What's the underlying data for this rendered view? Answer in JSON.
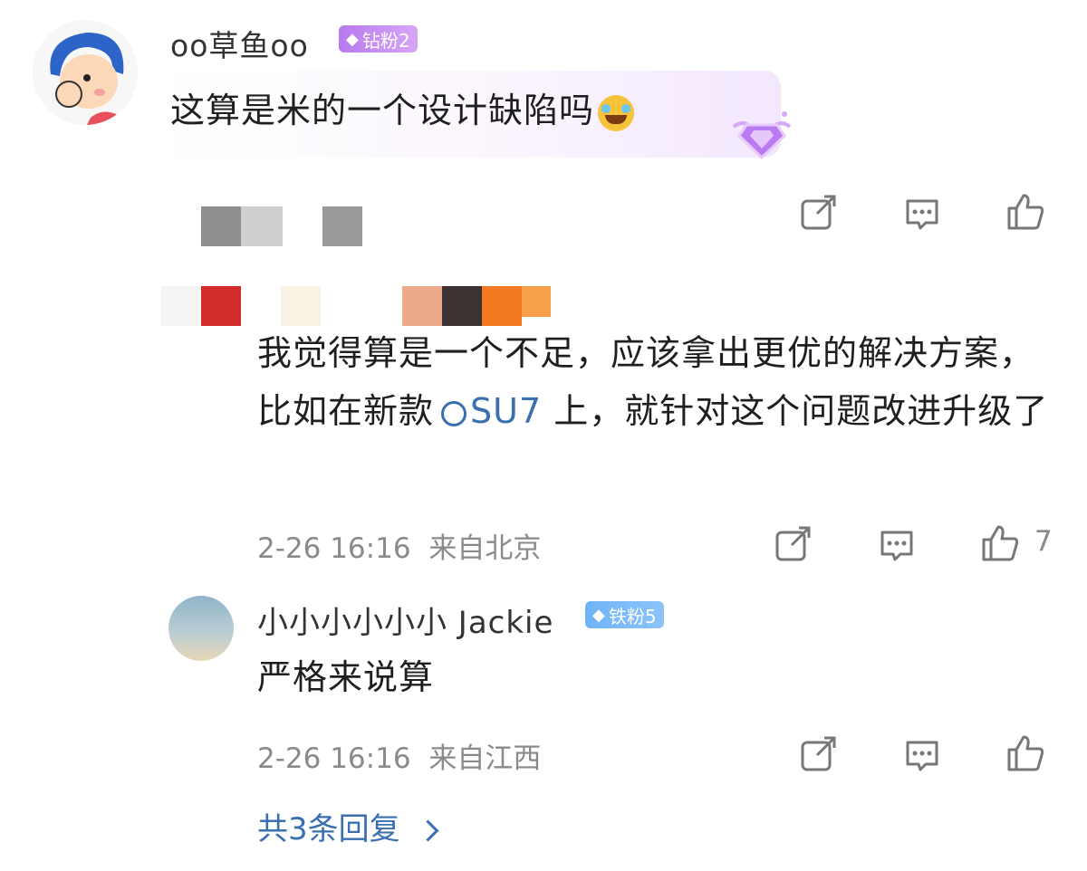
{
  "top_comment": {
    "username": "oo草鱼oo",
    "badge": "钻粉2",
    "badge_color": "#c98cf2",
    "text": "这算是米的一个设计缺陷吗",
    "emoji": "laughing-tears-emoji"
  },
  "reply_main": {
    "text_part1": "我觉得算是一个不足，应该拿出更优的解决方案，比如在新款",
    "link_text": "SU7",
    "text_part2": " 上，就针对这个问题改进升级了",
    "date": "2-26 16:16",
    "location": "来自北京",
    "like_count": "7"
  },
  "reply_second": {
    "username": "小小小小小小 Jackie",
    "badge": "铁粉5",
    "badge_color": "#5aa0f0",
    "text": "严格来说算",
    "date": "2-26 16:16",
    "location": "来自江西"
  },
  "more_replies": "共3条回复",
  "colors": {
    "link": "#3a6fb0",
    "meta": "#8a8a8a"
  }
}
